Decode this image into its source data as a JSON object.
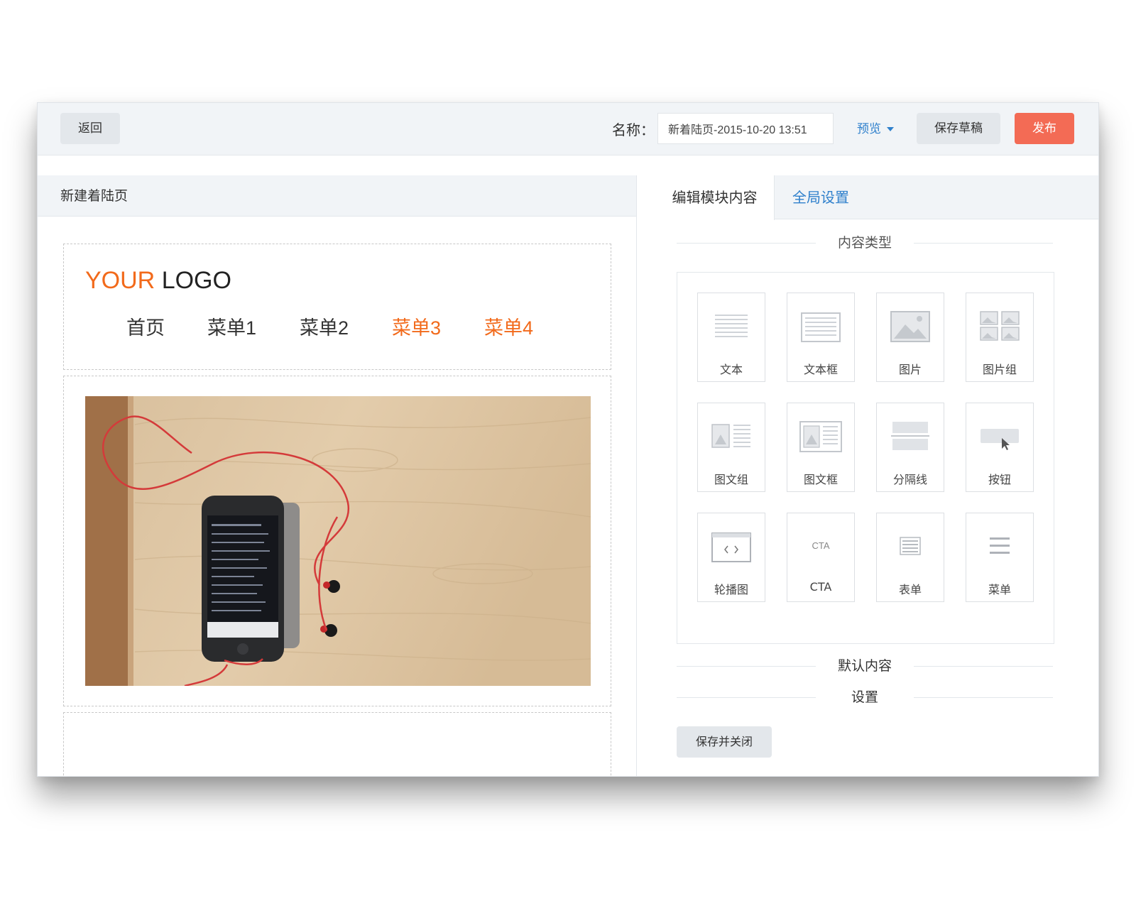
{
  "toolbar": {
    "back_label": "返回",
    "name_label": "名称：",
    "name_value": "新着陆页-2015-10-20 13:51",
    "preview_label": "预览",
    "save_draft_label": "保存草稿",
    "publish_label": "发布"
  },
  "editor": {
    "header_title": "新建着陆页",
    "logo": {
      "part1": "YOUR",
      "part2": "LOGO"
    },
    "nav": [
      "首页",
      "菜单1",
      "菜单2",
      "菜单3",
      "菜单4"
    ]
  },
  "panel": {
    "tabs": [
      "编辑模块内容",
      "全局设置"
    ],
    "content_type_title": "内容类型",
    "modules": [
      {
        "label": "文本",
        "icon": "text-icon"
      },
      {
        "label": "文本框",
        "icon": "textbox-icon"
      },
      {
        "label": "图片",
        "icon": "image-icon"
      },
      {
        "label": "图片组",
        "icon": "image-group-icon"
      },
      {
        "label": "图文组",
        "icon": "image-text-group-icon"
      },
      {
        "label": "图文框",
        "icon": "image-text-box-icon"
      },
      {
        "label": "分隔线",
        "icon": "divider-icon"
      },
      {
        "label": "按钮",
        "icon": "button-icon"
      },
      {
        "label": "轮播图",
        "icon": "carousel-icon"
      },
      {
        "label": "CTA",
        "icon": "cta-icon",
        "icon_text": "CTA"
      },
      {
        "label": "表单",
        "icon": "form-icon"
      },
      {
        "label": "菜单",
        "icon": "menu-icon"
      }
    ],
    "default_content_title": "默认内容",
    "settings_title": "设置",
    "save_close_label": "保存并关闭"
  },
  "colors": {
    "accent_orange": "#f26a1b",
    "publish_red": "#f36b55",
    "link_blue": "#2f80cc",
    "toolbar_bg": "#f1f4f7"
  }
}
